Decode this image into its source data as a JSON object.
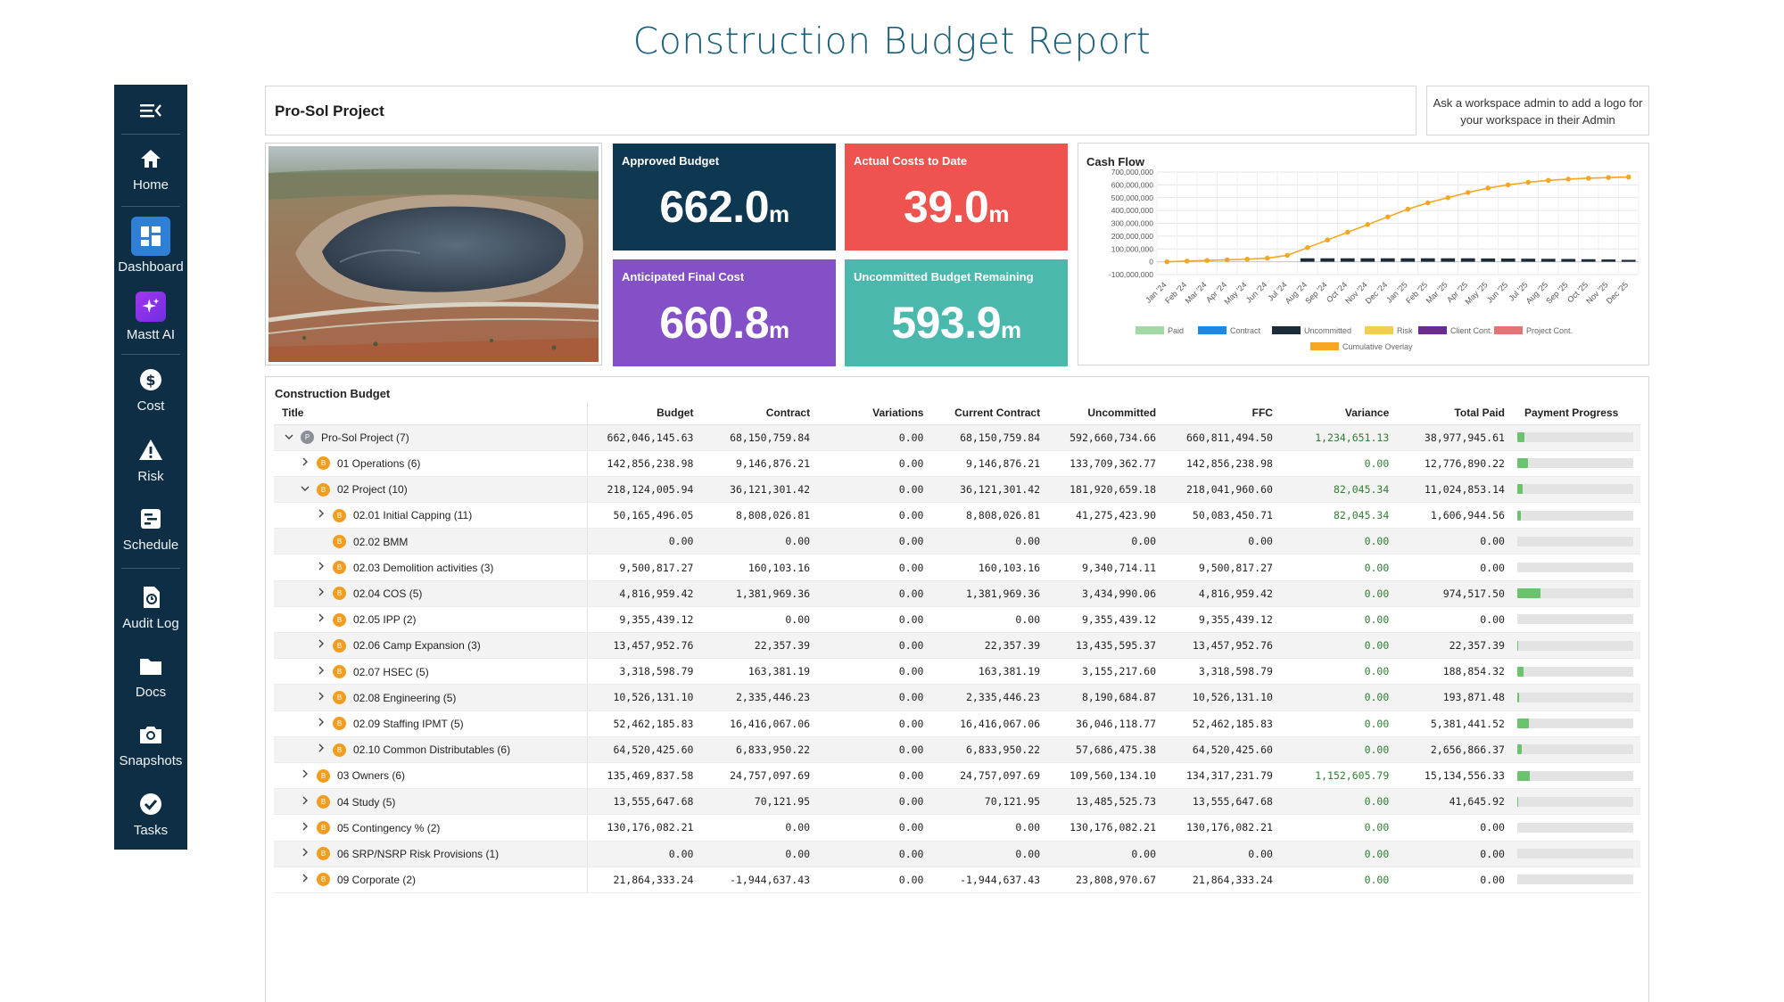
{
  "page": {
    "title": "Construction Budget Report"
  },
  "sidebar": {
    "items": [
      {
        "label": "",
        "icon": "menu-collapse-icon"
      },
      {
        "label": "Home",
        "icon": "home-icon"
      },
      {
        "label": "Dashboard",
        "icon": "dashboard-icon",
        "active": true
      },
      {
        "label": "Mastt AI",
        "icon": "sparkle-icon"
      },
      {
        "label": "Cost",
        "icon": "dollar-icon"
      },
      {
        "label": "Risk",
        "icon": "warning-icon"
      },
      {
        "label": "Schedule",
        "icon": "schedule-icon"
      },
      {
        "label": "Audit Log",
        "icon": "audit-icon"
      },
      {
        "label": "Docs",
        "icon": "folder-icon"
      },
      {
        "label": "Snapshots",
        "icon": "camera-icon"
      },
      {
        "label": "Tasks",
        "icon": "check-icon"
      }
    ]
  },
  "header": {
    "project_name": "Pro-Sol Project",
    "logo_note": "Ask a workspace admin to add a logo for your workspace in their Admin"
  },
  "kpis": {
    "approved": {
      "label": "Approved Budget",
      "value": "662.0",
      "unit": "m",
      "color": "#0e3752"
    },
    "actual": {
      "label": "Actual Costs to Date",
      "value": "39.0",
      "unit": "m",
      "color": "#ef5350"
    },
    "afc": {
      "label": "Anticipated Final Cost",
      "value": "660.8",
      "unit": "m",
      "color": "#8350c8"
    },
    "uncommitted": {
      "label": "Uncommitted Budget Remaining",
      "value": "593.9",
      "unit": "m",
      "color": "#4bb8ae"
    }
  },
  "chart_data": {
    "type": "bar",
    "title": "Cash Flow",
    "categories": [
      "Jan '24",
      "Feb '24",
      "Mar '24",
      "Apr '24",
      "May '24",
      "Jun '24",
      "Jul '24",
      "Aug '24",
      "Sep '24",
      "Oct '24",
      "Nov '24",
      "Dec '24",
      "Jan '25",
      "Feb '25",
      "Mar '25",
      "Apr '25",
      "May '25",
      "Jun '25",
      "Jul '25",
      "Aug '25",
      "Sep '25",
      "Oct '25",
      "Nov '25",
      "Dec '25"
    ],
    "yticks": [
      "700,000,000",
      "600,000,000",
      "500,000,000",
      "400,000,000",
      "300,000,000",
      "200,000,000",
      "100,000,000",
      "0",
      "-100,000,000"
    ],
    "ylim": [
      -100000000,
      700000000
    ],
    "series": [
      {
        "name": "Uncommitted",
        "type": "bar",
        "color": "#1c2b3a",
        "values": [
          0,
          0,
          0,
          0,
          0,
          0,
          0,
          27000000,
          27000000,
          27000000,
          27000000,
          27000000,
          27000000,
          27000000,
          27000000,
          27000000,
          26000000,
          25000000,
          24000000,
          23000000,
          22000000,
          20000000,
          18000000,
          15000000
        ]
      },
      {
        "name": "Cumulative Overlay",
        "type": "line",
        "color": "#f5a623",
        "values": [
          0,
          5000000,
          10000000,
          15000000,
          20000000,
          28000000,
          50000000,
          110000000,
          170000000,
          230000000,
          290000000,
          350000000,
          410000000,
          460000000,
          500000000,
          540000000,
          575000000,
          600000000,
          620000000,
          635000000,
          645000000,
          652000000,
          657000000,
          661000000
        ]
      }
    ],
    "legend": [
      {
        "name": "Paid",
        "color": "#a3d9a5"
      },
      {
        "name": "Contract",
        "color": "#1e88e5"
      },
      {
        "name": "Uncommitted",
        "color": "#1c2b3a"
      },
      {
        "name": "Risk",
        "color": "#f2cf4a"
      },
      {
        "name": "Client Cont.",
        "color": "#6a2c91"
      },
      {
        "name": "Project Cont.",
        "color": "#e57373"
      },
      {
        "name": "Cumulative Overlay",
        "color": "#f5a623"
      }
    ],
    "grid": true,
    "legend_position": "bottom"
  },
  "table": {
    "title": "Construction Budget",
    "columns": [
      "Title",
      "Budget",
      "Contract",
      "Variations",
      "Current Contract",
      "Uncommitted",
      "FFC",
      "Variance",
      "Total Paid",
      "Payment Progress"
    ],
    "rows": [
      {
        "level": 0,
        "chevron": "down",
        "badge": "P",
        "title": "Pro-Sol Project  (7)",
        "budget": "662,046,145.63",
        "contract": "68,150,759.84",
        "variations": "0.00",
        "current": "68,150,759.84",
        "uncommitted": "592,660,734.66",
        "ffc": "660,811,494.50",
        "variance": "1,234,651.13",
        "paid": "38,977,945.61",
        "progress": 0.06
      },
      {
        "level": 1,
        "chevron": "right",
        "badge": "B",
        "title": "01 Operations  (6)",
        "budget": "142,856,238.98",
        "contract": "9,146,876.21",
        "variations": "0.00",
        "current": "9,146,876.21",
        "uncommitted": "133,709,362.77",
        "ffc": "142,856,238.98",
        "variance": "0.00",
        "paid": "12,776,890.22",
        "progress": 0.09
      },
      {
        "level": 1,
        "chevron": "down",
        "badge": "B",
        "title": "02 Project  (10)",
        "budget": "218,124,005.94",
        "contract": "36,121,301.42",
        "variations": "0.00",
        "current": "36,121,301.42",
        "uncommitted": "181,920,659.18",
        "ffc": "218,041,960.60",
        "variance": "82,045.34",
        "paid": "11,024,853.14",
        "progress": 0.05
      },
      {
        "level": 2,
        "chevron": "right",
        "badge": "B",
        "title": "02.01 Initial Capping  (11)",
        "budget": "50,165,496.05",
        "contract": "8,808,026.81",
        "variations": "0.00",
        "current": "8,808,026.81",
        "uncommitted": "41,275,423.90",
        "ffc": "50,083,450.71",
        "variance": "82,045.34",
        "paid": "1,606,944.56",
        "progress": 0.03
      },
      {
        "level": 2,
        "chevron": "",
        "badge": "B",
        "title": "02.02 BMM",
        "budget": "0.00",
        "contract": "0.00",
        "variations": "0.00",
        "current": "0.00",
        "uncommitted": "0.00",
        "ffc": "0.00",
        "variance": "0.00",
        "paid": "0.00",
        "progress": 0
      },
      {
        "level": 2,
        "chevron": "right",
        "badge": "B",
        "title": "02.03 Demolition activities  (3)",
        "budget": "9,500,817.27",
        "contract": "160,103.16",
        "variations": "0.00",
        "current": "160,103.16",
        "uncommitted": "9,340,714.11",
        "ffc": "9,500,817.27",
        "variance": "0.00",
        "paid": "0.00",
        "progress": 0
      },
      {
        "level": 2,
        "chevron": "right",
        "badge": "B",
        "title": "02.04 COS  (5)",
        "budget": "4,816,959.42",
        "contract": "1,381,969.36",
        "variations": "0.00",
        "current": "1,381,969.36",
        "uncommitted": "3,434,990.06",
        "ffc": "4,816,959.42",
        "variance": "0.00",
        "paid": "974,517.50",
        "progress": 0.2
      },
      {
        "level": 2,
        "chevron": "right",
        "badge": "B",
        "title": "02.05 IPP  (2)",
        "budget": "9,355,439.12",
        "contract": "0.00",
        "variations": "0.00",
        "current": "0.00",
        "uncommitted": "9,355,439.12",
        "ffc": "9,355,439.12",
        "variance": "0.00",
        "paid": "0.00",
        "progress": 0
      },
      {
        "level": 2,
        "chevron": "right",
        "badge": "B",
        "title": "02.06 Camp Expansion  (3)",
        "budget": "13,457,952.76",
        "contract": "22,357.39",
        "variations": "0.00",
        "current": "22,357.39",
        "uncommitted": "13,435,595.37",
        "ffc": "13,457,952.76",
        "variance": "0.00",
        "paid": "22,357.39",
        "progress": 0.002
      },
      {
        "level": 2,
        "chevron": "right",
        "badge": "B",
        "title": "02.07 HSEC  (5)",
        "budget": "3,318,598.79",
        "contract": "163,381.19",
        "variations": "0.00",
        "current": "163,381.19",
        "uncommitted": "3,155,217.60",
        "ffc": "3,318,598.79",
        "variance": "0.00",
        "paid": "188,854.32",
        "progress": 0.057
      },
      {
        "level": 2,
        "chevron": "right",
        "badge": "B",
        "title": "02.08 Engineering  (5)",
        "budget": "10,526,131.10",
        "contract": "2,335,446.23",
        "variations": "0.00",
        "current": "2,335,446.23",
        "uncommitted": "8,190,684.87",
        "ffc": "10,526,131.10",
        "variance": "0.00",
        "paid": "193,871.48",
        "progress": 0.018
      },
      {
        "level": 2,
        "chevron": "right",
        "badge": "B",
        "title": "02.09 Staffing IPMT  (5)",
        "budget": "52,462,185.83",
        "contract": "16,416,067.06",
        "variations": "0.00",
        "current": "16,416,067.06",
        "uncommitted": "36,046,118.77",
        "ffc": "52,462,185.83",
        "variance": "0.00",
        "paid": "5,381,441.52",
        "progress": 0.1
      },
      {
        "level": 2,
        "chevron": "right",
        "badge": "B",
        "title": "02.10 Common Distributables  (6)",
        "budget": "64,520,425.60",
        "contract": "6,833,950.22",
        "variations": "0.00",
        "current": "6,833,950.22",
        "uncommitted": "57,686,475.38",
        "ffc": "64,520,425.60",
        "variance": "0.00",
        "paid": "2,656,866.37",
        "progress": 0.041
      },
      {
        "level": 1,
        "chevron": "right",
        "badge": "B",
        "title": "03 Owners  (6)",
        "budget": "135,469,837.58",
        "contract": "24,757,097.69",
        "variations": "0.00",
        "current": "24,757,097.69",
        "uncommitted": "109,560,134.10",
        "ffc": "134,317,231.79",
        "variance": "1,152,605.79",
        "paid": "15,134,556.33",
        "progress": 0.11
      },
      {
        "level": 1,
        "chevron": "right",
        "badge": "B",
        "title": "04 Study  (5)",
        "budget": "13,555,647.68",
        "contract": "70,121.95",
        "variations": "0.00",
        "current": "70,121.95",
        "uncommitted": "13,485,525.73",
        "ffc": "13,555,647.68",
        "variance": "0.00",
        "paid": "41,645.92",
        "progress": 0.003
      },
      {
        "level": 1,
        "chevron": "right",
        "badge": "B",
        "title": "05 Contingency %  (2)",
        "budget": "130,176,082.21",
        "contract": "0.00",
        "variations": "0.00",
        "current": "0.00",
        "uncommitted": "130,176,082.21",
        "ffc": "130,176,082.21",
        "variance": "0.00",
        "paid": "0.00",
        "progress": 0
      },
      {
        "level": 1,
        "chevron": "right",
        "badge": "B",
        "title": "06 SRP/NSRP Risk Provisions  (1)",
        "budget": "0.00",
        "contract": "0.00",
        "variations": "0.00",
        "current": "0.00",
        "uncommitted": "0.00",
        "ffc": "0.00",
        "variance": "0.00",
        "paid": "0.00",
        "progress": 0
      },
      {
        "level": 1,
        "chevron": "right",
        "badge": "B",
        "title": "09 Corporate  (2)",
        "budget": "21,864,333.24",
        "contract": "-1,944,637.43",
        "variations": "0.00",
        "current": "-1,944,637.43",
        "uncommitted": "23,808,970.67",
        "ffc": "21,864,333.24",
        "variance": "0.00",
        "paid": "0.00",
        "progress": 0
      }
    ]
  }
}
